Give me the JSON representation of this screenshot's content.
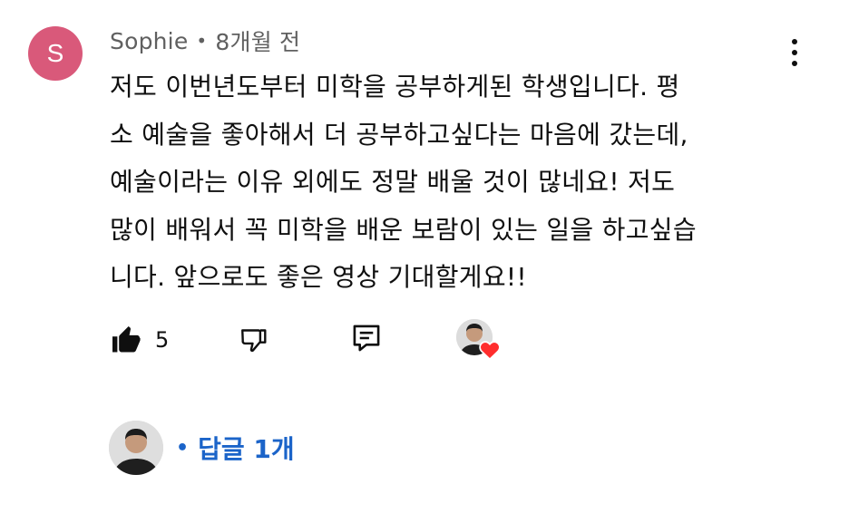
{
  "comment": {
    "author_initial": "S",
    "author": "Sophie",
    "separator": "•",
    "time": "8개월 전",
    "text_lines": [
      "저도 이번년도부터 미학을 공부하게된 학생입니다. 평",
      "소 예술을 좋아해서 더 공부하고싶다는 마음에 갔는데,",
      "예술이라는 이유 외에도 정말 배울 것이 많네요! 저도",
      "많이 배워서 꼭 미학을 배운 보람이 있는 일을 하고싶습",
      "니다. 앞으로도 좋은 영상 기대할게요!!"
    ],
    "avatar_color": "#d9597a"
  },
  "actions": {
    "like_count": "5",
    "like_icon": "thumbs-up-filled-icon",
    "dislike_icon": "thumbs-down-outline-icon",
    "reply_icon": "comment-reply-icon",
    "creator_heart_icon": "heart-icon",
    "heart_color": "#ff2d2d"
  },
  "replies": {
    "bullet": "•",
    "label": "답글 1개",
    "link_color": "#1b64c9"
  }
}
